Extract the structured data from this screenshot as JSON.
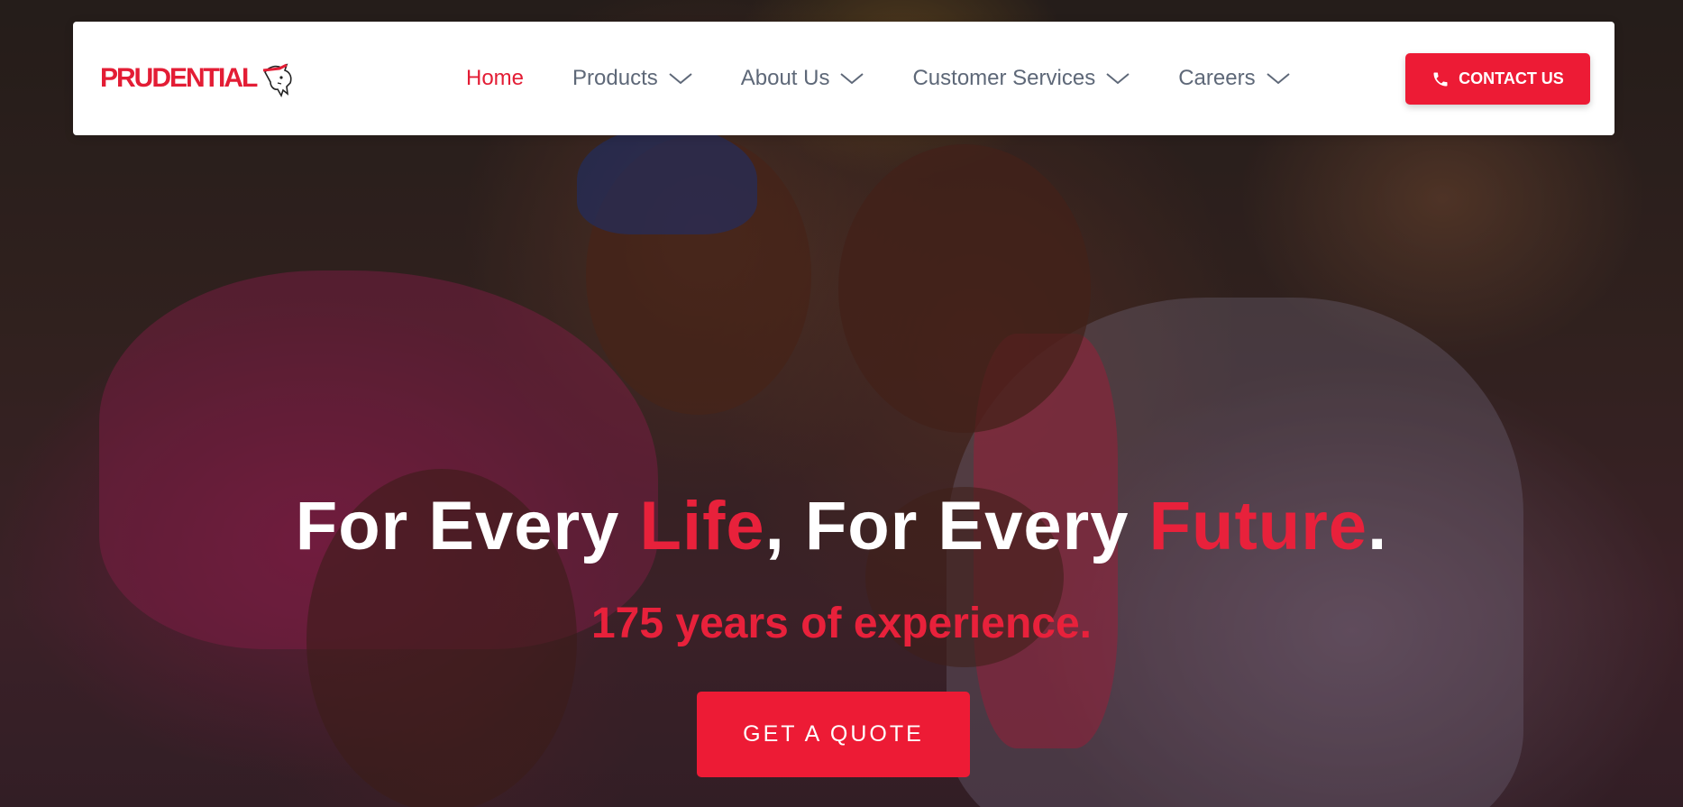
{
  "brand": {
    "name": "PRUDENTIAL",
    "color": "#e31d35"
  },
  "nav": {
    "items": [
      {
        "label": "Home",
        "active": true,
        "has_dropdown": false
      },
      {
        "label": "Products",
        "active": false,
        "has_dropdown": true
      },
      {
        "label": "About Us",
        "active": false,
        "has_dropdown": true
      },
      {
        "label": "Customer Services",
        "active": false,
        "has_dropdown": true
      },
      {
        "label": "Careers",
        "active": false,
        "has_dropdown": true
      }
    ],
    "contact_label": "CONTACT US",
    "contact_icon": "phone-icon"
  },
  "hero": {
    "headline": {
      "part1": "For Every ",
      "accent1": "Life",
      "part2": ", For Every ",
      "accent2": "Future",
      "part3": "."
    },
    "subheadline": "175 years of experience.",
    "cta_label": "GET A QUOTE",
    "accent_color": "#e8213b"
  }
}
